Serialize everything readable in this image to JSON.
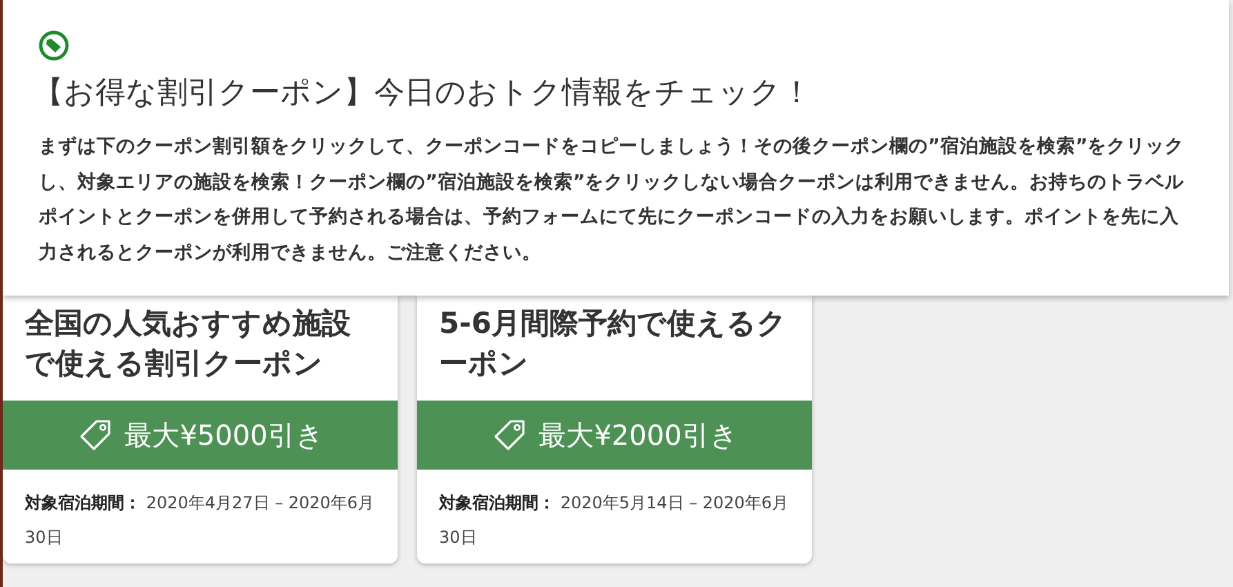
{
  "notice": {
    "title": "【お得な割引クーポン】今日のおトク情報をチェック！",
    "body": "まずは下のクーポン割引額をクリックして、クーポンコードをコピーしましょう！その後クーポン欄の”宿泊施設を検索”をクリックし、対象エリアの施設を検索！クーポン欄の”宿泊施設を検索”をクリックしない場合クーポンは利用できません。お持ちのトラベルポイントとクーポンを併用して予約される場合は、予約フォームにて先にクーポンコードの入力をお願いします。ポイントを先に入力されるとクーポンが利用できません。ご注意ください。"
  },
  "coupons": [
    {
      "title": "全国の人気おすすめ施設で使える割引クーポン",
      "discount": "最大¥5000引き",
      "period_label": "対象宿泊期間：",
      "period": "2020年4月27日 – 2020年6月30日"
    },
    {
      "title": "5-6月間際予約で使えるクーポン",
      "discount": "最大¥2000引き",
      "period_label": "対象宿泊期間：",
      "period": "2020年5月14日 – 2020年6月30日"
    }
  ]
}
